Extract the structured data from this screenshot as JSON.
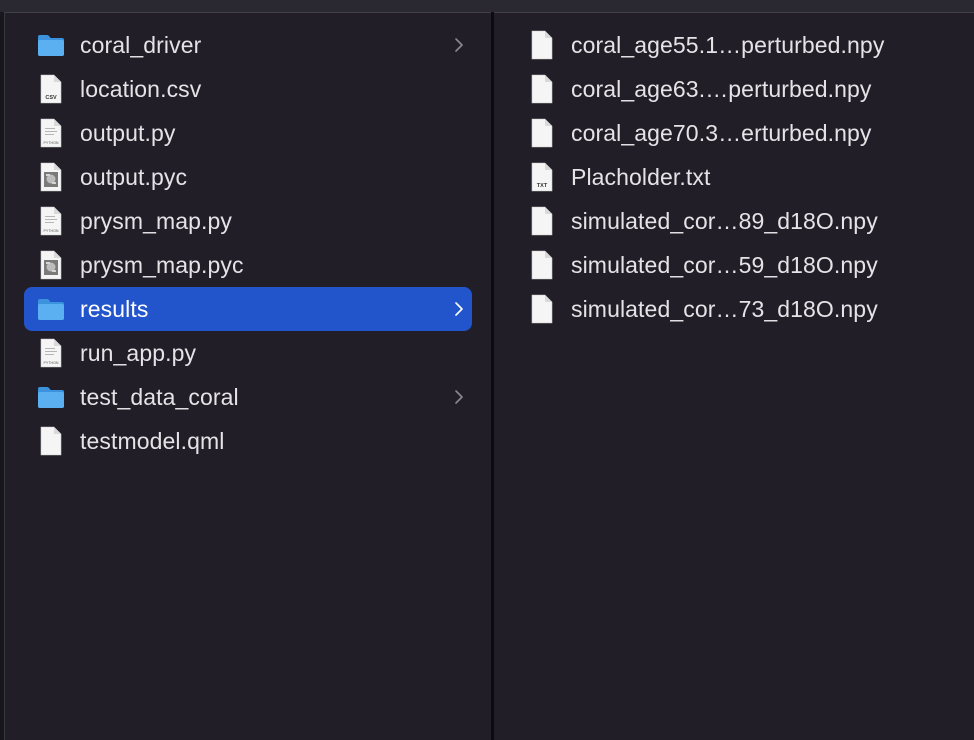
{
  "left_column": {
    "items": [
      {
        "name": "coral_driver",
        "type": "folder",
        "has_children": true,
        "selected": false
      },
      {
        "name": "location.csv",
        "type": "csv",
        "has_children": false,
        "selected": false
      },
      {
        "name": "output.py",
        "type": "python",
        "has_children": false,
        "selected": false
      },
      {
        "name": "output.pyc",
        "type": "pyc",
        "has_children": false,
        "selected": false
      },
      {
        "name": "prysm_map.py",
        "type": "python",
        "has_children": false,
        "selected": false
      },
      {
        "name": "prysm_map.pyc",
        "type": "pyc",
        "has_children": false,
        "selected": false
      },
      {
        "name": "results",
        "type": "folder",
        "has_children": true,
        "selected": true
      },
      {
        "name": "run_app.py",
        "type": "python",
        "has_children": false,
        "selected": false
      },
      {
        "name": "test_data_coral",
        "type": "folder",
        "has_children": true,
        "selected": false
      },
      {
        "name": "testmodel.qml",
        "type": "file",
        "has_children": false,
        "selected": false
      }
    ]
  },
  "right_column": {
    "items": [
      {
        "name": "coral_age55.1…perturbed.npy",
        "type": "file"
      },
      {
        "name": "coral_age63.…perturbed.npy",
        "type": "file"
      },
      {
        "name": "coral_age70.3…erturbed.npy",
        "type": "file"
      },
      {
        "name": "Placholder.txt",
        "type": "txt"
      },
      {
        "name": "simulated_cor…89_d18O.npy",
        "type": "file"
      },
      {
        "name": "simulated_cor…59_d18O.npy",
        "type": "file"
      },
      {
        "name": "simulated_cor…73_d18O.npy",
        "type": "file"
      }
    ]
  },
  "icon_labels": {
    "csv": "CSV",
    "python": "PYTHON",
    "txt": "TXT"
  },
  "icons": {
    "folder": "folder-icon",
    "csv": "csv-file-icon",
    "python": "python-file-icon",
    "pyc": "compiled-python-file-icon",
    "file": "document-icon",
    "txt": "text-file-icon",
    "chevron": "chevron-right-icon"
  },
  "colors": {
    "background": "#211e28",
    "selection": "#2255cc",
    "folder": "#4aa3ef",
    "text": "#e4e4e6"
  }
}
